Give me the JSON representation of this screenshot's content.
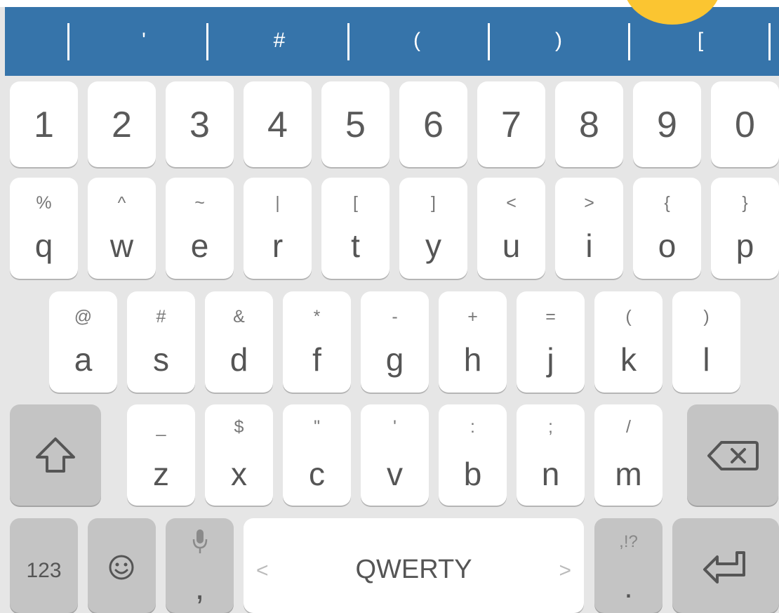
{
  "colors": {
    "symbol_bar": "#3674aa",
    "key_light": "#ffffff",
    "key_dark": "#c4c4c4",
    "keyboard_bg": "#e6e6e6",
    "accent": "#fbc531"
  },
  "symbol_bar": {
    "items": [
      "'",
      "#",
      "(",
      ")",
      "["
    ]
  },
  "number_row": [
    "1",
    "2",
    "3",
    "4",
    "5",
    "6",
    "7",
    "8",
    "9",
    "0"
  ],
  "row_q": [
    {
      "hint": "%",
      "label": "q"
    },
    {
      "hint": "^",
      "label": "w"
    },
    {
      "hint": "~",
      "label": "e"
    },
    {
      "hint": "|",
      "label": "r"
    },
    {
      "hint": "[",
      "label": "t"
    },
    {
      "hint": "]",
      "label": "y"
    },
    {
      "hint": "<",
      "label": "u"
    },
    {
      "hint": ">",
      "label": "i"
    },
    {
      "hint": "{",
      "label": "o"
    },
    {
      "hint": "}",
      "label": "p"
    }
  ],
  "row_a": [
    {
      "hint": "@",
      "label": "a"
    },
    {
      "hint": "#",
      "label": "s"
    },
    {
      "hint": "&",
      "label": "d"
    },
    {
      "hint": "*",
      "label": "f"
    },
    {
      "hint": "-",
      "label": "g"
    },
    {
      "hint": "+",
      "label": "h"
    },
    {
      "hint": "=",
      "label": "j"
    },
    {
      "hint": "(",
      "label": "k"
    },
    {
      "hint": ")",
      "label": "l"
    }
  ],
  "row_z": [
    {
      "hint": "_",
      "label": "z"
    },
    {
      "hint": "$",
      "label": "x"
    },
    {
      "hint": "\"",
      "label": "c"
    },
    {
      "hint": "'",
      "label": "v"
    },
    {
      "hint": ":",
      "label": "b"
    },
    {
      "hint": ";",
      "label": "n"
    },
    {
      "hint": "/",
      "label": "m"
    }
  ],
  "icons": {
    "shift": "shift-arrow-icon",
    "backspace": "backspace-icon",
    "emoji": "smiley-icon",
    "mic": "microphone-icon",
    "enter": "enter-arrow-icon"
  },
  "bottom_row": {
    "numbers_label": "123",
    "mic_key_label": ",",
    "space_label": "QWERTY",
    "space_left_chevron": "<",
    "space_right_chevron": ">",
    "punct_hint": ",!?",
    "punct_label": "."
  }
}
